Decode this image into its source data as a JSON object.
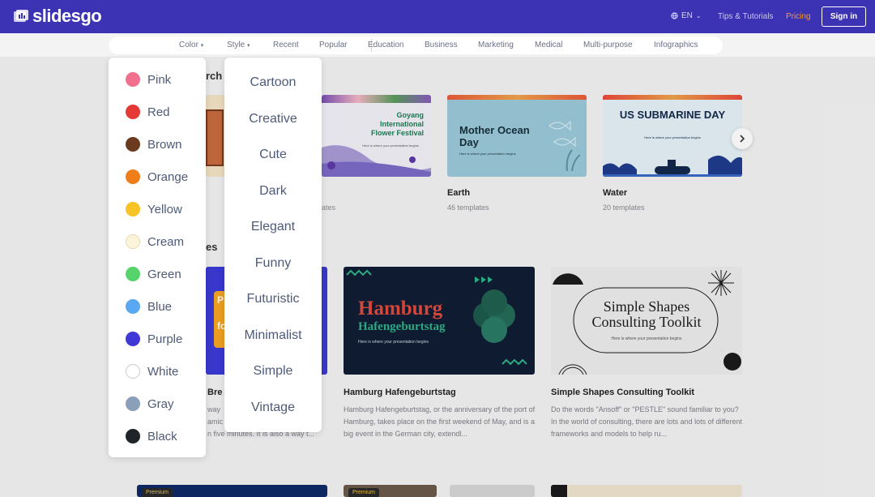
{
  "header": {
    "logo_text": "slidesgo",
    "lang": "EN",
    "tips_link": "Tips & Tutorials",
    "pricing_link": "Pricing",
    "signin_label": "Sign in"
  },
  "categories": {
    "color": "Color",
    "style": "Style",
    "items": [
      "Recent",
      "Popular",
      "Education",
      "Business",
      "Marketing",
      "Medical",
      "Multi-purpose",
      "Infographics"
    ]
  },
  "color_menu": [
    {
      "label": "Pink",
      "color": "#f0708e"
    },
    {
      "label": "Red",
      "color": "#e53935"
    },
    {
      "label": "Brown",
      "color": "#6b3a1f"
    },
    {
      "label": "Orange",
      "color": "#ee7d1a"
    },
    {
      "label": "Yellow",
      "color": "#f7c325"
    },
    {
      "label": "Cream",
      "color": "#fdf4dc"
    },
    {
      "label": "Green",
      "color": "#56d46b"
    },
    {
      "label": "Blue",
      "color": "#58a8f2"
    },
    {
      "label": "Purple",
      "color": "#3f38d6"
    },
    {
      "label": "White",
      "color": "#ffffff"
    },
    {
      "label": "Gray",
      "color": "#8aa0b8"
    },
    {
      "label": "Black",
      "color": "#1f2428"
    }
  ],
  "style_menu": [
    "Cartoon",
    "Creative",
    "Cute",
    "Dark",
    "Elegant",
    "Funny",
    "Futuristic",
    "Minimalist",
    "Simple",
    "Vintage"
  ],
  "section1": {
    "heading_fragment": "rch",
    "cards": [
      {
        "title": "Earth",
        "sub": "46 templates"
      },
      {
        "title": "Water",
        "sub": "20 templates"
      }
    ],
    "partial_sub": "ates",
    "thumb_texts": {
      "goyang_title": "Goyang International Flower Festival",
      "mother_title": "Mother Ocean Day",
      "submarine_title": "US SUBMARINE DAY",
      "tagline": "Here is where your presentation begins"
    }
  },
  "section2": {
    "heading_fragment": "es",
    "cards": [
      {
        "title": "Hamburg Hafengeburtstag",
        "thumb_line1": "Hamburg",
        "thumb_line2": "Hafengeburtstag",
        "desc": "Hamburg Hafengeburtstag, or the anniversary of the port of Hamburg, takes place on the first weekend of May, and is a big event in the German city, extendl..."
      },
      {
        "title": "Simple Shapes Consulting Toolkit",
        "thumb_line1": "Simple Shapes",
        "thumb_line2": "Consulting Toolkit",
        "desc": "Do the words \"Ansoff\" or \"PESTLE\" sound familiar to you? In the world of consulting, there are lots and lots of different frameworks and models to help ru..."
      }
    ],
    "partial_title": "Bre",
    "partial_desc": [
      "way",
      "amic",
      "n five minutes. It is also a way t..."
    ],
    "partial_thumb": [
      "P",
      "fo"
    ]
  },
  "premium_badges": [
    "Premium",
    "Premium"
  ]
}
